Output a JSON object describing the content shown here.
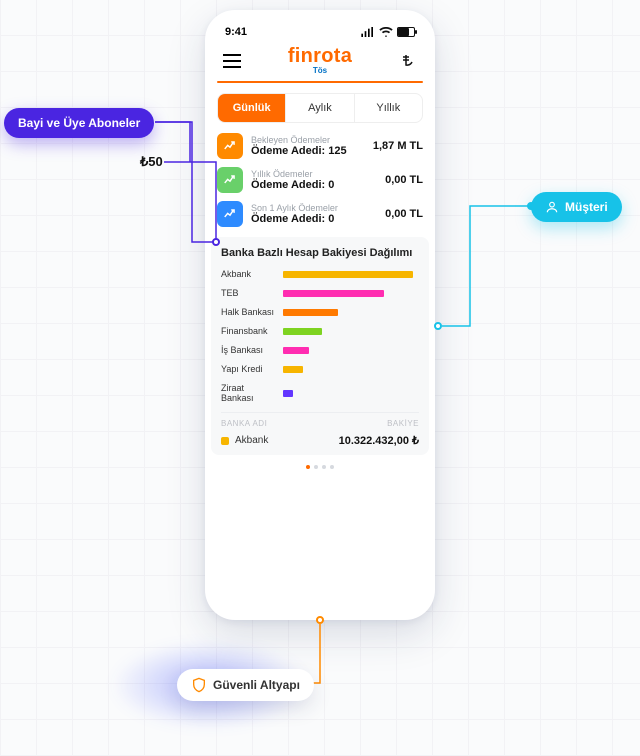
{
  "status": {
    "time": "9:41"
  },
  "header": {
    "brand": "finrota",
    "sub": "Tös"
  },
  "segments": {
    "g": "Günlük",
    "a": "Aylık",
    "y": "Yıllık"
  },
  "stats": [
    {
      "title": "Bekleyen Ödemeler",
      "count_label": "Ödeme Adedi: 125",
      "amount": "1,87 M TL",
      "color": "#ff8a00"
    },
    {
      "title": "Yıllık Ödemeler",
      "count_label": "Ödeme Adedi: 0",
      "amount": "0,00 TL",
      "color": "#69d06a"
    },
    {
      "title": "Son 1 Aylık Ödemeler",
      "count_label": "Ödeme Adedi: 0",
      "amount": "0,00 TL",
      "color": "#2e8bff"
    }
  ],
  "chart_title": "Banka Bazlı Hesap Bakiyesi Dağılımı",
  "chart_data": {
    "type": "bar",
    "orientation": "horizontal",
    "title": "Banka Bazlı Hesap Bakiyesi Dağılımı",
    "ylabel": "Banka",
    "xlabel": "Bakiye",
    "categories": [
      "Akbank",
      "TEB",
      "Halk Bankası",
      "Finansbank",
      "İş Bankası",
      "Yapı Kredi",
      "Ziraat Bankası"
    ],
    "values_pct": [
      100,
      78,
      42,
      30,
      20,
      15,
      8
    ],
    "colors": [
      "#f7b500",
      "#ff2db1",
      "#ff7a00",
      "#7ed321",
      "#ff2db1",
      "#f7b500",
      "#6236ff"
    ],
    "series": [
      {
        "name": "Bakiye",
        "values_pct": [
          100,
          78,
          42,
          30,
          20,
          15,
          8
        ]
      }
    ]
  },
  "table": {
    "h1": "BANKA ADI",
    "h2": "BAKİYE",
    "row": {
      "dot": "#f7b500",
      "name": "Akbank",
      "balance": "10.322.432,00 ₺"
    }
  },
  "annotations": {
    "left_pill": "Bayi ve Üye Aboneler",
    "badge50": "₺50",
    "right_pill": "Müşteri",
    "bottom_pill": "Güvenli Altyapı"
  }
}
